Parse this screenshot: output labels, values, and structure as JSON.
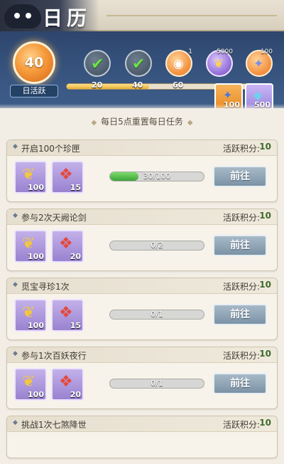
{
  "header": {
    "title": "日历",
    "activity_value": "40",
    "activity_label": "日活跃",
    "progress_fraction": 0.4,
    "milestones": [
      {
        "label": "20",
        "done": true,
        "icon": "check-icon"
      },
      {
        "label": "40",
        "done": true,
        "icon": "check-icon"
      },
      {
        "label": "60",
        "done": false,
        "count": "1",
        "icon": "orb-icon"
      },
      {
        "label": "",
        "done": false,
        "count": "5000",
        "icon": "feather-icon"
      },
      {
        "label": "",
        "done": false,
        "count": "100",
        "icon": "gem-icon"
      }
    ],
    "extra_rewards": [
      "100",
      "500"
    ]
  },
  "banner": "每日5点重置每日任务",
  "points_label": "活跃积分:",
  "go_label": "前往",
  "tasks": [
    {
      "name": "开启100个珍匣",
      "points": "10",
      "rewards": [
        "100",
        "15"
      ],
      "progress": "30/100",
      "fraction": 0.3
    },
    {
      "name": "参与2次天阙论剑",
      "points": "10",
      "rewards": [
        "100",
        "20"
      ],
      "progress": "0/2",
      "fraction": 0
    },
    {
      "name": "觅宝寻珍1次",
      "points": "10",
      "rewards": [
        "100",
        "15"
      ],
      "progress": "0/1",
      "fraction": 0
    },
    {
      "name": "参与1次百妖夜行",
      "points": "10",
      "rewards": [
        "100",
        "20"
      ],
      "progress": "0/1",
      "fraction": 0
    },
    {
      "name": "挑战1次七煞降世",
      "points": "10"
    }
  ],
  "colors": {
    "header_bg": "#34507a",
    "go_button": "#7c93a6",
    "reward_bg": "#9a82d0",
    "points_value": "#3d6a2b"
  }
}
